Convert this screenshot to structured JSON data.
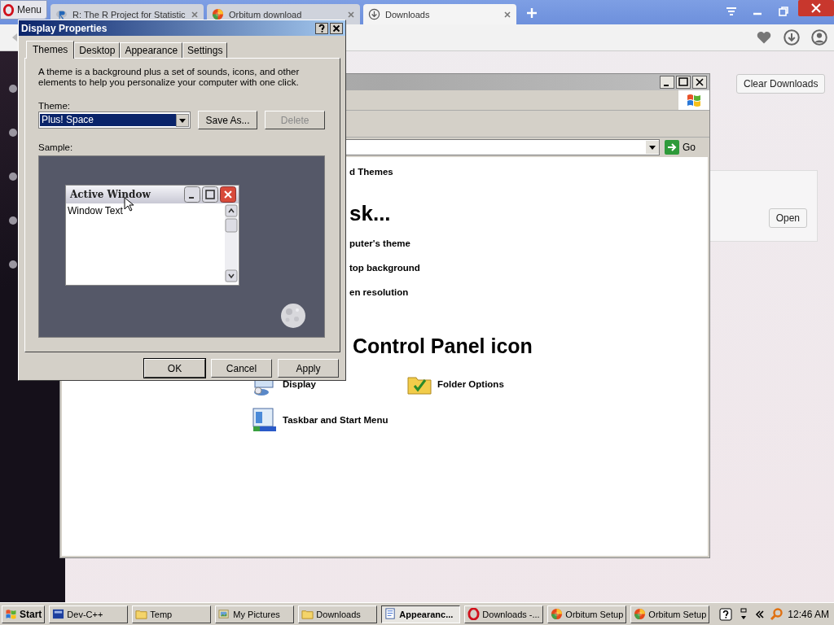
{
  "browser": {
    "menu_label": "Menu",
    "tabs": [
      {
        "title": "R: The R Project for Statistic",
        "kind": "r",
        "selected": false
      },
      {
        "title": "Orbitum download",
        "kind": "orbitum",
        "selected": false
      },
      {
        "title": "Downloads",
        "kind": "download",
        "selected": true
      }
    ],
    "page": {
      "clear_button": "Clear Downloads",
      "open_button": "Open"
    }
  },
  "explorer": {
    "go_label": "Go",
    "lines": [
      {
        "kind": "link",
        "text": "d Themes"
      },
      {
        "kind": "heading",
        "text": "sk..."
      },
      {
        "kind": "link",
        "text": "puter's theme"
      },
      {
        "kind": "link",
        "text": "top background"
      },
      {
        "kind": "link",
        "text": "en resolution"
      },
      {
        "kind": "heading2",
        "text": "Control Panel icon"
      }
    ],
    "icons": [
      {
        "label": "Display",
        "kind": "display"
      },
      {
        "label": "Folder Options",
        "kind": "folder"
      },
      {
        "label": "Taskbar and Start Menu",
        "kind": "taskbar"
      }
    ]
  },
  "dialog": {
    "title": "Display Properties",
    "tabs": [
      {
        "label": "Themes",
        "selected": true
      },
      {
        "label": "Desktop",
        "selected": false
      },
      {
        "label": "Appearance",
        "selected": false
      },
      {
        "label": "Settings",
        "selected": false
      }
    ],
    "description": "A theme is a background plus a set of sounds, icons, and other elements to help you personalize your computer with one click.",
    "theme_label": "Theme:",
    "theme_value": "Plus! Space",
    "theme_buttons": [
      {
        "label": "Save As...",
        "disabled": false
      },
      {
        "label": "Delete",
        "disabled": true
      }
    ],
    "sample_label": "Sample:",
    "sample": {
      "window_title": "Active Window",
      "window_text": "Window Text"
    },
    "buttons": [
      "OK",
      "Cancel",
      "Apply"
    ]
  },
  "taskbar": {
    "start": "Start",
    "items": [
      {
        "label": "Dev-C++",
        "kind": "devcpp",
        "selected": false
      },
      {
        "label": "Temp",
        "kind": "folder",
        "selected": false
      },
      {
        "label": "My Pictures",
        "kind": "pictures",
        "selected": false
      },
      {
        "label": "Downloads",
        "kind": "folder",
        "selected": false
      },
      {
        "label": "Appearanc...",
        "kind": "display",
        "selected": true
      },
      {
        "label": "Downloads -...",
        "kind": "opera",
        "selected": false
      },
      {
        "label": "Orbitum Setup",
        "kind": "orbitum",
        "selected": false
      },
      {
        "label": "Orbitum Setup",
        "kind": "orbitum",
        "selected": false
      }
    ],
    "clock": "12:46 AM"
  }
}
